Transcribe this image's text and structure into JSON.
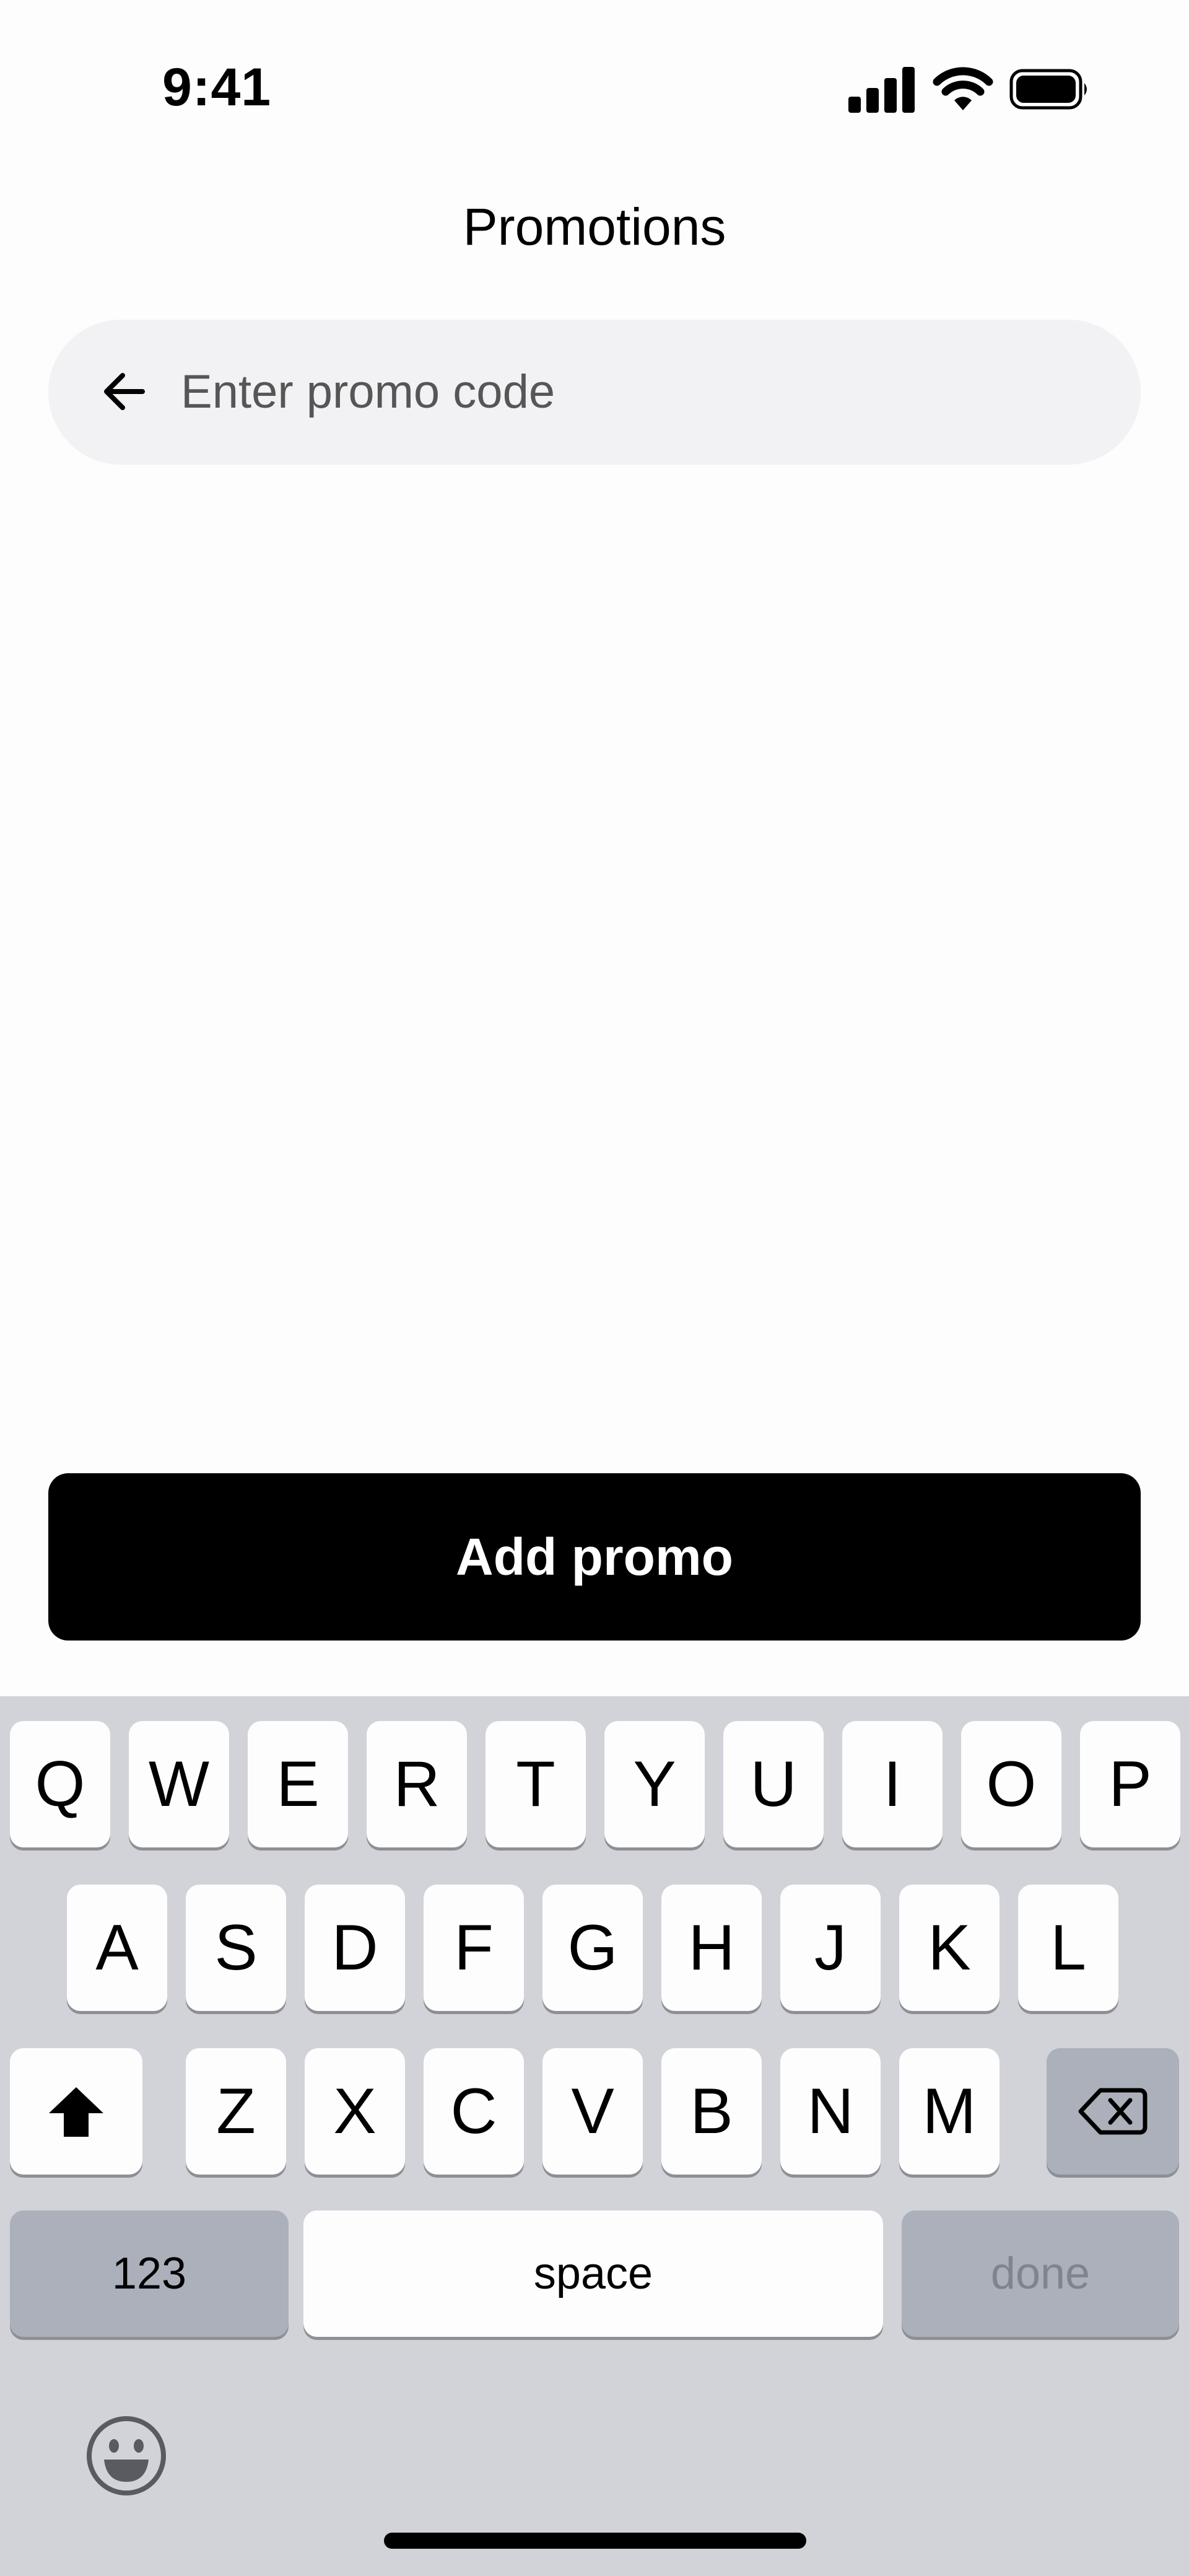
{
  "status_bar": {
    "time": "9:41",
    "icons": [
      "cellular-signal-icon",
      "wifi-icon",
      "battery-icon"
    ]
  },
  "header": {
    "title": "Promotions"
  },
  "promo_input": {
    "value": "",
    "placeholder": "Enter promo code",
    "icon": "arrow-left-icon"
  },
  "add_button": {
    "label": "Add promo"
  },
  "keyboard": {
    "row1": [
      "Q",
      "W",
      "E",
      "R",
      "T",
      "Y",
      "U",
      "I",
      "O",
      "P"
    ],
    "row2": [
      "A",
      "S",
      "D",
      "F",
      "G",
      "H",
      "J",
      "K",
      "L"
    ],
    "row3": [
      "Z",
      "X",
      "C",
      "V",
      "B",
      "N",
      "M"
    ],
    "shift_icon": "shift-icon",
    "delete_icon": "backspace-icon",
    "numbers_label": "123",
    "space_label": "space",
    "done_label": "done",
    "emoji_icon": "emoji-icon"
  },
  "colors": {
    "background": "#fdfdfd",
    "field_background": "#f2f1f3",
    "button_background": "#000000",
    "button_text": "#ffffff",
    "keyboard_background": "#d2d3d8",
    "key_background": "#fdfdfd",
    "special_key_background": "#abb0bb"
  }
}
